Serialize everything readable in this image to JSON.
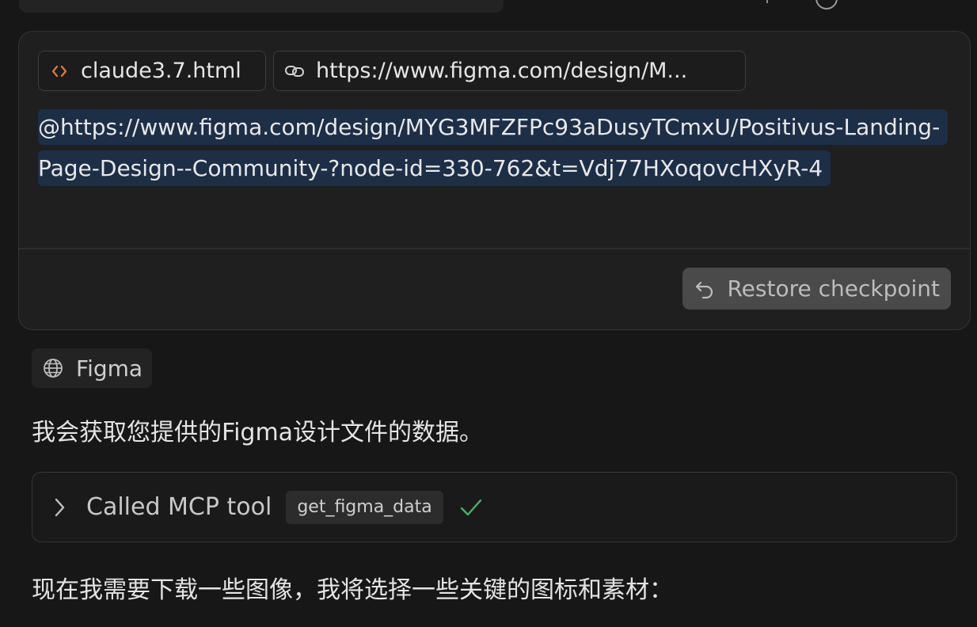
{
  "message": {
    "attachments": [
      {
        "label": "claude3.7.html",
        "icon": "code-icon"
      },
      {
        "label": "https://www.figma.com/design/M...",
        "icon": "link-icon"
      }
    ],
    "url_text": "@https://www.figma.com/design/MYG3MFZFPc93aDusyTCmxU/Positivus-Landing-Page-Design--Community-?node-id=330-762&t=Vdj77HXoqovcHXyR-4",
    "restore_label": "Restore checkpoint"
  },
  "assistant": {
    "source_label": "Figma",
    "intro_text": "我会获取您提供的Figma设计文件的数据。",
    "tool_call": {
      "label": "Called MCP tool",
      "tool_name": "get_figma_data",
      "status": "success"
    },
    "followup_text": "现在我需要下载一些图像，我将选择一些关键的图标和素材："
  },
  "colors": {
    "background": "#171717",
    "card": "#1f1f1f",
    "highlight": "#1d2e47",
    "code_icon": "#e07a3a",
    "success": "#4caf6a"
  }
}
